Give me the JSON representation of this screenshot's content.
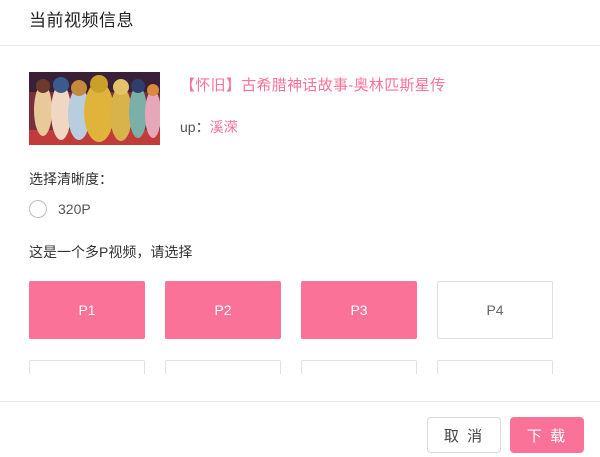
{
  "dialog": {
    "title": "当前视频信息"
  },
  "video": {
    "title": "【怀旧】古希腊神话故事-奥林匹斯星传",
    "uploader_prefix": "up：",
    "uploader_name": "溪溁"
  },
  "quality": {
    "label": "选择清晰度：",
    "options": [
      {
        "label": "320P",
        "selected": false
      }
    ]
  },
  "parts": {
    "label": "这是一个多P视频，请选择",
    "items": [
      {
        "label": "P1",
        "selected": true
      },
      {
        "label": "P2",
        "selected": true
      },
      {
        "label": "P3",
        "selected": true
      },
      {
        "label": "P4",
        "selected": false
      },
      {
        "label": "",
        "selected": false
      },
      {
        "label": "",
        "selected": false
      },
      {
        "label": "",
        "selected": false
      },
      {
        "label": "",
        "selected": false
      }
    ]
  },
  "footer": {
    "cancel_label": "取 消",
    "download_label": "下 载"
  },
  "colors": {
    "accent": "#fb7299",
    "border": "#e0e0e0"
  }
}
